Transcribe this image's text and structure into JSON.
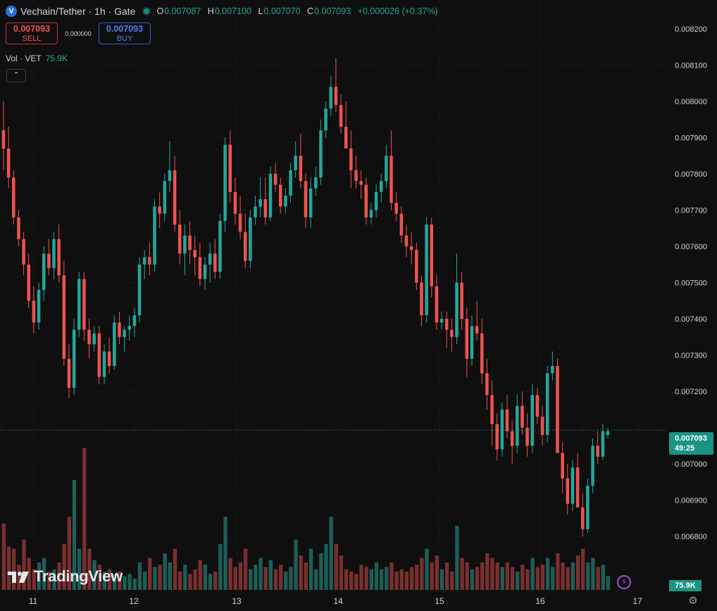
{
  "header": {
    "symbol_icon": "vechain-logo-icon",
    "symbol_letter": "V",
    "title": "Vechain/Tether · 1h · Gate",
    "ohlc": {
      "o_label": "O",
      "o_value": "0.007087",
      "h_label": "H",
      "h_value": "0.007100",
      "l_label": "L",
      "l_value": "0.007070",
      "c_label": "C",
      "c_value": "0.007093",
      "change": "+0.000026 (+0.37%)"
    }
  },
  "trade": {
    "sell_price": "0.007093",
    "sell_label": "SELL",
    "spread": "0.000000",
    "buy_price": "0.007093",
    "buy_label": "BUY"
  },
  "volume_legend": {
    "label": "Vol · VET",
    "value": "75.9K"
  },
  "collapse_icon": "chevron-up-icon",
  "collapse_glyph": "⌃",
  "logo_text": "TradingView",
  "last_price": {
    "price": "0.007093",
    "countdown": "49:25"
  },
  "volume_tag": "75.9K",
  "settings_glyph": "⚙",
  "bolt_glyph": "⚡",
  "colors": {
    "up": "#26a69a",
    "down": "#ef5350",
    "background": "#0f0f0f",
    "grid": "#2a2a2a"
  },
  "chart_data": {
    "type": "candlestick",
    "title": "Vechain/Tether · 1h · Gate",
    "ylim": [
      0.00675,
      0.00825
    ],
    "y_ticks": [
      "0.008200",
      "0.008100",
      "0.008000",
      "0.007900",
      "0.007800",
      "0.007700",
      "0.007600",
      "0.007500",
      "0.007400",
      "0.007300",
      "0.007200",
      "0.007000",
      "0.006900",
      "0.006800"
    ],
    "x_ticks": [
      "11",
      "12",
      "13",
      "14",
      "15",
      "16",
      "17"
    ],
    "current_price_line": 0.007093,
    "candles": [
      [
        0.00792,
        0.008,
        0.00781,
        0.00787,
        29
      ],
      [
        0.00787,
        0.00793,
        0.00776,
        0.00779,
        19
      ],
      [
        0.00779,
        0.00781,
        0.00766,
        0.00768,
        18
      ],
      [
        0.00768,
        0.0077,
        0.0076,
        0.00762,
        11
      ],
      [
        0.00762,
        0.00764,
        0.00752,
        0.00755,
        22
      ],
      [
        0.00755,
        0.00758,
        0.00743,
        0.00745,
        14
      ],
      [
        0.00745,
        0.00749,
        0.00736,
        0.00739,
        9
      ],
      [
        0.00739,
        0.0075,
        0.00737,
        0.00748,
        12
      ],
      [
        0.00748,
        0.0076,
        0.00745,
        0.00758,
        14
      ],
      [
        0.00758,
        0.00762,
        0.00752,
        0.00754,
        8
      ],
      [
        0.00754,
        0.00764,
        0.00751,
        0.00762,
        9
      ],
      [
        0.00762,
        0.00766,
        0.0075,
        0.00752,
        12
      ],
      [
        0.00752,
        0.00756,
        0.00727,
        0.00729,
        20
      ],
      [
        0.00729,
        0.00733,
        0.00718,
        0.00721,
        32
      ],
      [
        0.00721,
        0.0074,
        0.00719,
        0.00737,
        48
      ],
      [
        0.00737,
        0.00753,
        0.00735,
        0.00751,
        18
      ],
      [
        0.00751,
        0.00753,
        0.00734,
        0.00737,
        62
      ],
      [
        0.00737,
        0.0074,
        0.00729,
        0.00733,
        18
      ],
      [
        0.00733,
        0.00738,
        0.00731,
        0.00736,
        13
      ],
      [
        0.00736,
        0.00738,
        0.00722,
        0.00724,
        11
      ],
      [
        0.00724,
        0.00733,
        0.00722,
        0.00731,
        8
      ],
      [
        0.00731,
        0.00735,
        0.00725,
        0.00727,
        9
      ],
      [
        0.00727,
        0.00741,
        0.00726,
        0.00739,
        7
      ],
      [
        0.00739,
        0.00742,
        0.00733,
        0.00735,
        8
      ],
      [
        0.00735,
        0.00738,
        0.00731,
        0.00737,
        6
      ],
      [
        0.00737,
        0.00741,
        0.00734,
        0.00738,
        7
      ],
      [
        0.00738,
        0.00743,
        0.00735,
        0.00741,
        5
      ],
      [
        0.00741,
        0.00757,
        0.00739,
        0.00755,
        12
      ],
      [
        0.00755,
        0.00759,
        0.00751,
        0.00757,
        8
      ],
      [
        0.00757,
        0.00761,
        0.00752,
        0.00755,
        14
      ],
      [
        0.00755,
        0.00773,
        0.00753,
        0.00771,
        10
      ],
      [
        0.00771,
        0.00775,
        0.00765,
        0.00769,
        11
      ],
      [
        0.00769,
        0.0078,
        0.00767,
        0.00778,
        16
      ],
      [
        0.00778,
        0.00789,
        0.00775,
        0.00781,
        12
      ],
      [
        0.00781,
        0.00785,
        0.00764,
        0.00766,
        18
      ],
      [
        0.00766,
        0.0077,
        0.00755,
        0.00758,
        8
      ],
      [
        0.00758,
        0.00766,
        0.00752,
        0.00763,
        11
      ],
      [
        0.00763,
        0.00767,
        0.00755,
        0.00759,
        7
      ],
      [
        0.00759,
        0.00763,
        0.00752,
        0.00757,
        9
      ],
      [
        0.00757,
        0.00761,
        0.00749,
        0.00751,
        13
      ],
      [
        0.00751,
        0.00757,
        0.00748,
        0.00755,
        11
      ],
      [
        0.00755,
        0.00761,
        0.0075,
        0.00758,
        7
      ],
      [
        0.00758,
        0.00762,
        0.00751,
        0.00753,
        8
      ],
      [
        0.00753,
        0.00769,
        0.00751,
        0.00767,
        20
      ],
      [
        0.00767,
        0.0079,
        0.00764,
        0.00788,
        32
      ],
      [
        0.00788,
        0.00792,
        0.00772,
        0.00775,
        14
      ],
      [
        0.00775,
        0.00779,
        0.00766,
        0.00769,
        10
      ],
      [
        0.00769,
        0.00774,
        0.00762,
        0.00764,
        12
      ],
      [
        0.00764,
        0.00769,
        0.00754,
        0.00756,
        18
      ],
      [
        0.00756,
        0.0077,
        0.00754,
        0.00768,
        9
      ],
      [
        0.00768,
        0.00774,
        0.00766,
        0.00771,
        11
      ],
      [
        0.00771,
        0.00779,
        0.00768,
        0.00773,
        14
      ],
      [
        0.00773,
        0.00779,
        0.00766,
        0.00768,
        10
      ],
      [
        0.00768,
        0.00782,
        0.00767,
        0.0078,
        13
      ],
      [
        0.0078,
        0.00783,
        0.00775,
        0.00777,
        9
      ],
      [
        0.00777,
        0.00779,
        0.00769,
        0.00771,
        11
      ],
      [
        0.00771,
        0.00776,
        0.00769,
        0.00774,
        8
      ],
      [
        0.00774,
        0.00783,
        0.00772,
        0.00781,
        10
      ],
      [
        0.00781,
        0.00789,
        0.00779,
        0.00785,
        22
      ],
      [
        0.00785,
        0.00791,
        0.00776,
        0.00778,
        15
      ],
      [
        0.00778,
        0.0078,
        0.00765,
        0.00768,
        12
      ],
      [
        0.00768,
        0.00779,
        0.00765,
        0.00776,
        18
      ],
      [
        0.00776,
        0.00782,
        0.00774,
        0.00779,
        9
      ],
      [
        0.00779,
        0.00795,
        0.00777,
        0.00792,
        16
      ],
      [
        0.00792,
        0.008,
        0.0079,
        0.00798,
        20
      ],
      [
        0.00798,
        0.00807,
        0.00796,
        0.00804,
        32
      ],
      [
        0.00804,
        0.00812,
        0.00797,
        0.00799,
        20
      ],
      [
        0.00799,
        0.00802,
        0.00791,
        0.00793,
        15
      ],
      [
        0.00793,
        0.008,
        0.00788,
        0.00787,
        9
      ],
      [
        0.00787,
        0.00792,
        0.00776,
        0.00781,
        8
      ],
      [
        0.00781,
        0.00785,
        0.00776,
        0.00778,
        7
      ],
      [
        0.00778,
        0.00781,
        0.00773,
        0.00777,
        11
      ],
      [
        0.00777,
        0.00779,
        0.00766,
        0.00768,
        10
      ],
      [
        0.00768,
        0.00772,
        0.00766,
        0.0077,
        9
      ],
      [
        0.0077,
        0.00777,
        0.00768,
        0.00775,
        12
      ],
      [
        0.00775,
        0.0078,
        0.00772,
        0.00778,
        9
      ],
      [
        0.00778,
        0.00788,
        0.00776,
        0.00785,
        10
      ],
      [
        0.00785,
        0.00792,
        0.0077,
        0.00772,
        12
      ],
      [
        0.00772,
        0.00775,
        0.00767,
        0.00769,
        8
      ],
      [
        0.00769,
        0.00771,
        0.00761,
        0.00763,
        9
      ],
      [
        0.00763,
        0.00766,
        0.00757,
        0.0076,
        8
      ],
      [
        0.0076,
        0.00764,
        0.00755,
        0.00759,
        10
      ],
      [
        0.00759,
        0.00761,
        0.00748,
        0.0075,
        11
      ],
      [
        0.0075,
        0.00752,
        0.00738,
        0.00741,
        14
      ],
      [
        0.00741,
        0.00768,
        0.00739,
        0.00766,
        18
      ],
      [
        0.00766,
        0.00768,
        0.00746,
        0.00749,
        12
      ],
      [
        0.00749,
        0.00752,
        0.00737,
        0.00739,
        15
      ],
      [
        0.00739,
        0.00742,
        0.00737,
        0.0074,
        9
      ],
      [
        0.0074,
        0.00742,
        0.00732,
        0.00737,
        12
      ],
      [
        0.00737,
        0.0074,
        0.00731,
        0.00735,
        8
      ],
      [
        0.00735,
        0.00758,
        0.00733,
        0.0075,
        28
      ],
      [
        0.0075,
        0.00753,
        0.00737,
        0.0074,
        14
      ],
      [
        0.0074,
        0.00743,
        0.00724,
        0.00729,
        12
      ],
      [
        0.00729,
        0.00741,
        0.00727,
        0.00738,
        9
      ],
      [
        0.00738,
        0.00745,
        0.00734,
        0.00736,
        10
      ],
      [
        0.00736,
        0.0074,
        0.00722,
        0.00725,
        12
      ],
      [
        0.00725,
        0.00729,
        0.00715,
        0.00719,
        16
      ],
      [
        0.00719,
        0.00723,
        0.00705,
        0.00711,
        14
      ],
      [
        0.00711,
        0.00714,
        0.00701,
        0.00704,
        12
      ],
      [
        0.00704,
        0.00717,
        0.00702,
        0.00715,
        10
      ],
      [
        0.00715,
        0.00719,
        0.00707,
        0.00709,
        12
      ],
      [
        0.00709,
        0.00712,
        0.007,
        0.00705,
        10
      ],
      [
        0.00705,
        0.00719,
        0.00703,
        0.00716,
        8
      ],
      [
        0.00716,
        0.0072,
        0.00708,
        0.0071,
        11
      ],
      [
        0.0071,
        0.00714,
        0.00702,
        0.00705,
        9
      ],
      [
        0.00705,
        0.00722,
        0.00703,
        0.00719,
        14
      ],
      [
        0.00719,
        0.00721,
        0.00711,
        0.00713,
        10
      ],
      [
        0.00713,
        0.00716,
        0.00705,
        0.00708,
        11
      ],
      [
        0.00708,
        0.00727,
        0.00706,
        0.00725,
        14
      ],
      [
        0.00725,
        0.00731,
        0.00723,
        0.00727,
        10
      ],
      [
        0.00727,
        0.00729,
        0.00705,
        0.00703,
        16
      ],
      [
        0.00703,
        0.00706,
        0.00692,
        0.00696,
        12
      ],
      [
        0.00696,
        0.007,
        0.00686,
        0.00689,
        10
      ],
      [
        0.00689,
        0.00701,
        0.00687,
        0.00699,
        12
      ],
      [
        0.00699,
        0.00703,
        0.0069,
        0.00688,
        15
      ],
      [
        0.00688,
        0.00692,
        0.0068,
        0.00682,
        18
      ],
      [
        0.00682,
        0.00696,
        0.00681,
        0.00694,
        12
      ],
      [
        0.00694,
        0.00707,
        0.00692,
        0.00705,
        14
      ],
      [
        0.00705,
        0.00709,
        0.007,
        0.00702,
        10
      ],
      [
        0.00702,
        0.00711,
        0.00701,
        0.00709,
        11
      ],
      [
        0.00708,
        0.0071,
        0.00707,
        0.00709,
        6
      ]
    ]
  }
}
